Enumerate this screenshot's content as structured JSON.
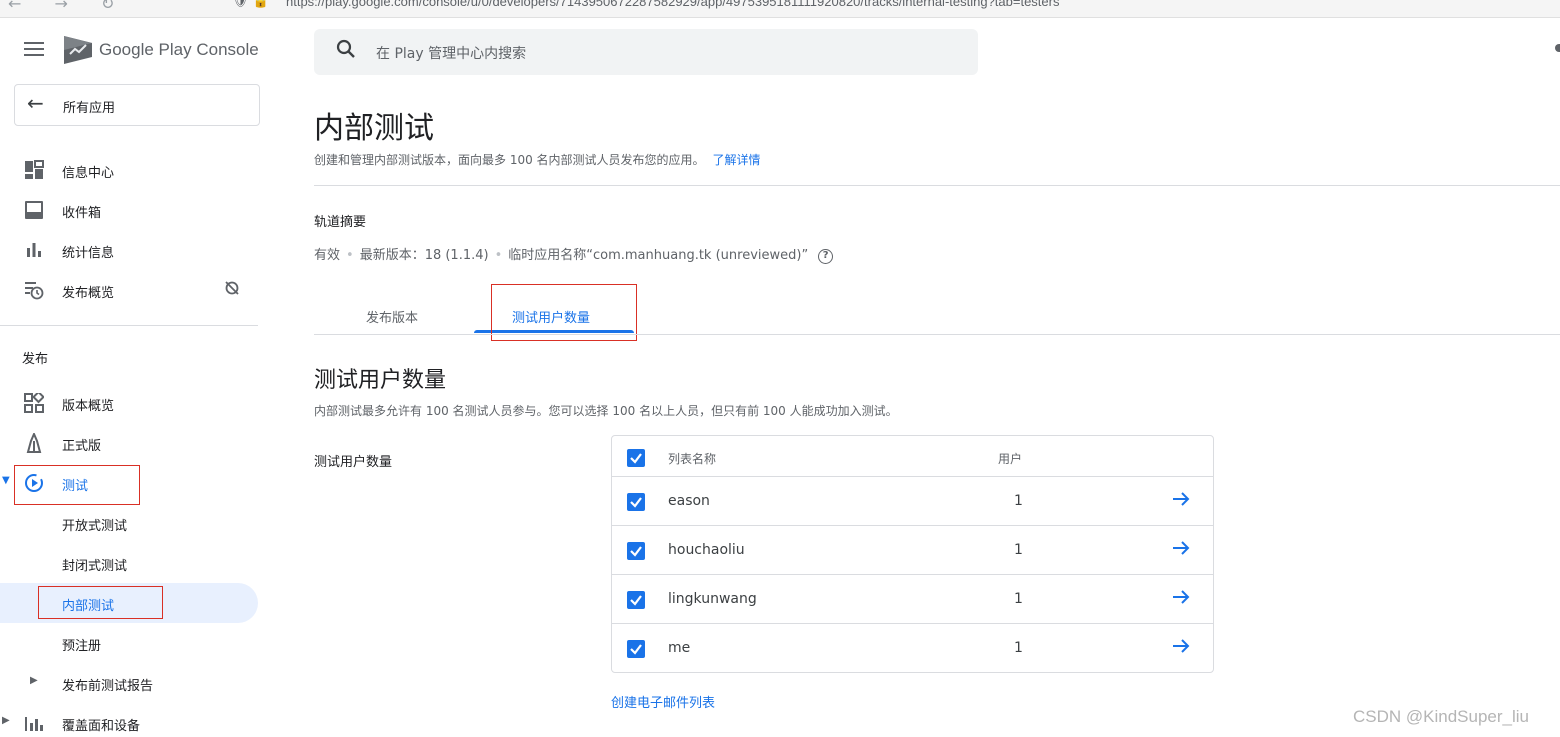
{
  "browser": {
    "nav_glyphs": "← → ↻",
    "url": "https://play.google.com/console/u/0/developers/7143950672287582929/app/4975395181111920820/tracks/internal-testing?tab=testers"
  },
  "sidebar": {
    "brand": "Google Play Console",
    "all_apps_label": "所有应用",
    "top_items": [
      {
        "label": "信息中心",
        "icon": "dashboard-icon"
      },
      {
        "label": "收件箱",
        "icon": "inbox-icon"
      },
      {
        "label": "统计信息",
        "icon": "bar-chart-icon"
      },
      {
        "label": "发布概览",
        "icon": "publishing-overview-icon"
      }
    ],
    "section_title": "发布",
    "release_items": [
      {
        "label": "版本概览"
      },
      {
        "label": "正式版"
      },
      {
        "label": "测试"
      },
      {
        "label": "开放式测试"
      },
      {
        "label": "封闭式测试"
      },
      {
        "label": "内部测试"
      },
      {
        "label": "预注册"
      },
      {
        "label": "发布前测试报告"
      },
      {
        "label": "覆盖面和设备"
      }
    ]
  },
  "search": {
    "placeholder": "在 Play 管理中心内搜索"
  },
  "page": {
    "title": "内部测试",
    "description": "创建和管理内部测试版本，面向最多 100 名内部测试人员发布您的应用。",
    "learn_more": "了解详情"
  },
  "track": {
    "title": "轨道摘要",
    "status": "有效",
    "latest_version": "最新版本：18 (1.1.4)",
    "temp_name": "临时应用名称“com.manhuang.tk (unreviewed)”",
    "help": "?"
  },
  "tabs": [
    {
      "label": "发布版本",
      "active": false
    },
    {
      "label": "测试用户数量",
      "active": true
    }
  ],
  "testers": {
    "title": "测试用户数量",
    "description": "内部测试最多允许有 100 名测试人员参与。您可以选择 100 名以上人员，但只有前 100 人能成功加入测试。",
    "field_label": "测试用户数量",
    "columns": {
      "name": "列表名称",
      "users": "用户"
    },
    "rows": [
      {
        "name": "eason",
        "users": "1",
        "checked": true
      },
      {
        "name": "houchaoliu",
        "users": "1",
        "checked": true
      },
      {
        "name": "lingkunwang",
        "users": "1",
        "checked": true
      },
      {
        "name": "me",
        "users": "1",
        "checked": true
      }
    ],
    "create_list_link": "创建电子邮件列表"
  },
  "watermark": "CSDN @KindSuper_liu",
  "colors": {
    "accent": "#1a73e8",
    "highlight_box": "#d93025",
    "active_bg": "#e8f0fe"
  }
}
